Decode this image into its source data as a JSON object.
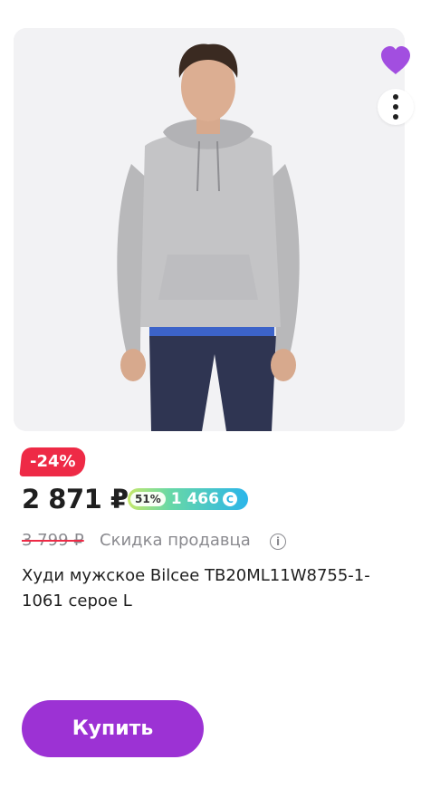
{
  "product": {
    "image_alt": "Худи мужское Bilcee серое",
    "discount_badge": "-24%",
    "price": "2 871 ₽",
    "bonus": {
      "percent": "51%",
      "value": "1 466",
      "coin_symbol": "С"
    },
    "old_price": "3 799 ₽",
    "seller_discount_label": "Скидка продавца",
    "info_symbol": "i",
    "title": "Худи мужское Bilcee TB20ML11W8755-1-1061 серое L",
    "buy_label": "Купить"
  },
  "colors": {
    "accent": "#9c32d4",
    "favorite": "#a24ee0",
    "discount": "#ee2a46"
  },
  "icons": [
    "heart-icon",
    "more-vertical-icon",
    "info-icon"
  ]
}
